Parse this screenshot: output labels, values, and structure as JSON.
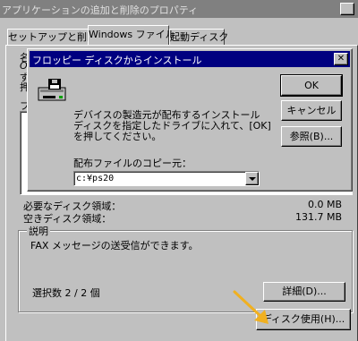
{
  "bg_window": {
    "title": "アプリケーションの追加と削除のプロパティ",
    "help_button": "?",
    "tabs": [
      {
        "label": "セットアップと削除"
      },
      {
        "label": "Windows ファイル"
      },
      {
        "label": "起動ディスク"
      }
    ],
    "partial_glyphs": [
      "名",
      "O",
      "ず",
      "押",
      "フ"
    ],
    "required_space_label": "必要なディスク領域：",
    "required_space_value": "0.0 MB",
    "free_space_label": "空きディスク領域：",
    "free_space_value": "131.7 MB",
    "description_group_label": "説明",
    "description_text": "FAX メッセージの送受信ができます。",
    "selection_count": "選択数 2 / 2 個",
    "details_button": "詳細(D)...",
    "have_disk_button": "ディスク使用(H)...",
    "highlight_color": "#f0b020"
  },
  "dialog": {
    "title": "フロッピー ディスクからインストール",
    "close_label": "✕",
    "message": "デバイスの製造元が配布するインストール ディスクを指定したドライブに入れて、[OK] を押してください。",
    "ok_button": "OK",
    "cancel_button": "キャンセル",
    "browse_button": "参照(B)...",
    "copy_from_label": "配布ファイルのコピー元：",
    "copy_from_value": "c:¥ps20",
    "icon": "floppy-drive-icon"
  },
  "colors": {
    "face": "#c0c0c0",
    "active_title": "#000080",
    "inactive_title": "#808080",
    "arrow": "#f0b020"
  }
}
